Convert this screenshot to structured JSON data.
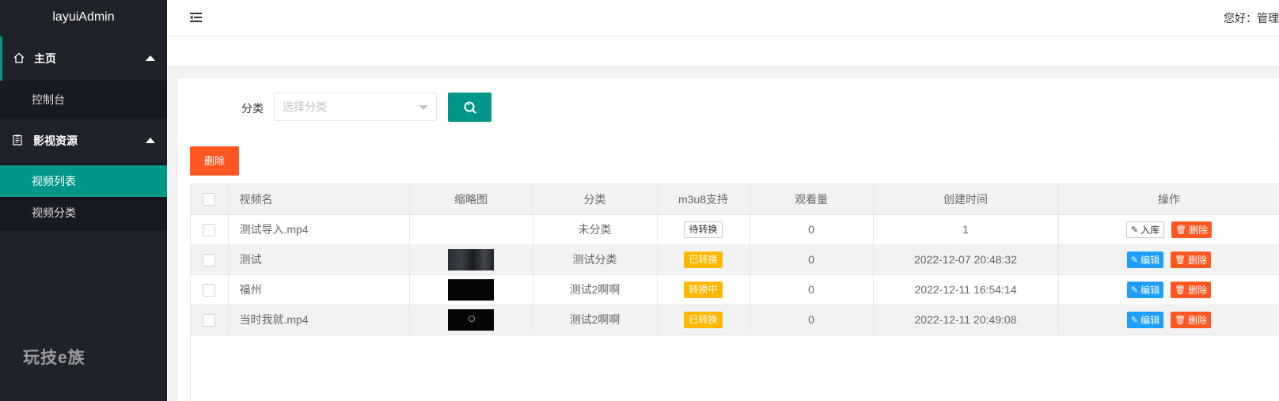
{
  "app": {
    "title": "layuiAdmin"
  },
  "sidebar": {
    "brand_mark": "玩技e族",
    "groups": [
      {
        "label": "主页",
        "icon": "home-icon",
        "items": [
          {
            "label": "控制台"
          }
        ]
      },
      {
        "label": "影视资源",
        "icon": "document-icon",
        "items": [
          {
            "label": "视频列表",
            "active": true
          },
          {
            "label": "视频分类"
          }
        ]
      }
    ]
  },
  "header": {
    "greeting": "您好：管理"
  },
  "filter": {
    "category_label": "分类",
    "category_placeholder": "选择分类",
    "search_icon": "search-icon"
  },
  "toolbar": {
    "delete_label": "删除"
  },
  "table": {
    "columns": [
      "视频名",
      "缩略图",
      "分类",
      "m3u8支持",
      "观看量",
      "创建时间",
      "操作"
    ],
    "rows": [
      {
        "name": "测试导入.mp4",
        "thumbnail": "",
        "category": "未分类",
        "m3u8": "待转换",
        "views": "0",
        "created": "1",
        "actions": [
          "入库",
          "删除"
        ]
      },
      {
        "name": "测试",
        "thumbnail": "dark-scene",
        "category": "测试分类",
        "m3u8": "已转换",
        "views": "0",
        "created": "2022-12-07 20:48:32",
        "actions": [
          "编辑",
          "删除"
        ]
      },
      {
        "name": "福州",
        "thumbnail": "black",
        "category": "测试2啊啊",
        "m3u8": "转换中",
        "views": "0",
        "created": "2022-12-11 16:54:14",
        "actions": [
          "编辑",
          "删除"
        ]
      },
      {
        "name": "当时我就.mp4",
        "thumbnail": "black-logo",
        "category": "测试2啊啊",
        "m3u8": "已转换",
        "views": "0",
        "created": "2022-12-11 20:49:08",
        "actions": [
          "编辑",
          "删除"
        ]
      }
    ]
  },
  "colors": {
    "sidebar_bg": "#20222a",
    "accent": "#009688",
    "danger": "#ff5722",
    "warn": "#ffb800",
    "info": "#1e9fff"
  }
}
